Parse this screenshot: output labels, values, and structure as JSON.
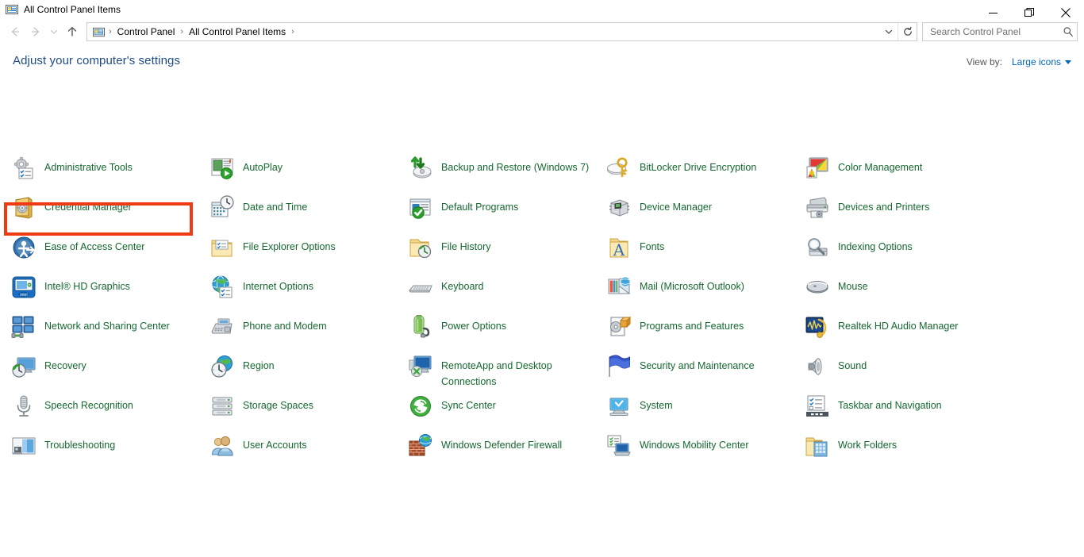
{
  "window": {
    "title": "All Control Panel Items",
    "app_icon": "control-panel-icon",
    "minimize_label": "Minimize",
    "maximize_label": "Maximize",
    "close_label": "Close"
  },
  "navbar": {
    "back_label": "Back",
    "forward_label": "Forward",
    "recent_label": "Recent locations",
    "up_label": "Up",
    "breadcrumbs": [
      "Control Panel",
      "All Control Panel Items"
    ],
    "separator": "›",
    "dropdown_label": "Previous locations",
    "refresh_label": "Refresh"
  },
  "search": {
    "placeholder": "Search Control Panel",
    "value": "",
    "icon": "search-icon"
  },
  "page": {
    "heading": "Adjust your computer's settings",
    "viewby_label": "View by:",
    "viewby_value": "Large icons",
    "heading_color": "#1f4c87",
    "item_color": "#15682f",
    "highlight_color": "#ef3b14"
  },
  "items": [
    {
      "label": "Administrative Tools",
      "icon": "administrative-tools-icon"
    },
    {
      "label": "AutoPlay",
      "icon": "autoplay-icon"
    },
    {
      "label": "Backup and Restore (Windows 7)",
      "icon": "backup-restore-icon"
    },
    {
      "label": "BitLocker Drive Encryption",
      "icon": "bitlocker-icon"
    },
    {
      "label": "Color Management",
      "icon": "color-management-icon"
    },
    {
      "label": "Credential Manager",
      "icon": "credential-manager-icon",
      "highlighted": true
    },
    {
      "label": "Date and Time",
      "icon": "date-time-icon"
    },
    {
      "label": "Default Programs",
      "icon": "default-programs-icon"
    },
    {
      "label": "Device Manager",
      "icon": "device-manager-icon"
    },
    {
      "label": "Devices and Printers",
      "icon": "devices-printers-icon"
    },
    {
      "label": "Ease of Access Center",
      "icon": "ease-of-access-icon"
    },
    {
      "label": "File Explorer Options",
      "icon": "file-explorer-options-icon"
    },
    {
      "label": "File History",
      "icon": "file-history-icon"
    },
    {
      "label": "Fonts",
      "icon": "fonts-icon"
    },
    {
      "label": "Indexing Options",
      "icon": "indexing-options-icon"
    },
    {
      "label": "Intel® HD Graphics",
      "icon": "intel-hd-graphics-icon"
    },
    {
      "label": "Internet Options",
      "icon": "internet-options-icon"
    },
    {
      "label": "Keyboard",
      "icon": "keyboard-icon"
    },
    {
      "label": "Mail (Microsoft Outlook)",
      "icon": "mail-outlook-icon"
    },
    {
      "label": "Mouse",
      "icon": "mouse-icon"
    },
    {
      "label": "Network and Sharing Center",
      "icon": "network-sharing-icon"
    },
    {
      "label": "Phone and Modem",
      "icon": "phone-modem-icon"
    },
    {
      "label": "Power Options",
      "icon": "power-options-icon"
    },
    {
      "label": "Programs and Features",
      "icon": "programs-features-icon"
    },
    {
      "label": "Realtek HD Audio Manager",
      "icon": "realtek-audio-icon"
    },
    {
      "label": "Recovery",
      "icon": "recovery-icon"
    },
    {
      "label": "Region",
      "icon": "region-icon"
    },
    {
      "label": "RemoteApp and Desktop Connections",
      "icon": "remoteapp-icon"
    },
    {
      "label": "Security and Maintenance",
      "icon": "security-maintenance-icon"
    },
    {
      "label": "Sound",
      "icon": "sound-icon"
    },
    {
      "label": "Speech Recognition",
      "icon": "speech-recognition-icon"
    },
    {
      "label": "Storage Spaces",
      "icon": "storage-spaces-icon"
    },
    {
      "label": "Sync Center",
      "icon": "sync-center-icon"
    },
    {
      "label": "System",
      "icon": "system-icon"
    },
    {
      "label": "Taskbar and Navigation",
      "icon": "taskbar-navigation-icon"
    },
    {
      "label": "Troubleshooting",
      "icon": "troubleshooting-icon"
    },
    {
      "label": "User Accounts",
      "icon": "user-accounts-icon"
    },
    {
      "label": "Windows Defender Firewall",
      "icon": "windows-defender-firewall-icon"
    },
    {
      "label": "Windows Mobility Center",
      "icon": "windows-mobility-icon"
    },
    {
      "label": "Work Folders",
      "icon": "work-folders-icon"
    }
  ]
}
